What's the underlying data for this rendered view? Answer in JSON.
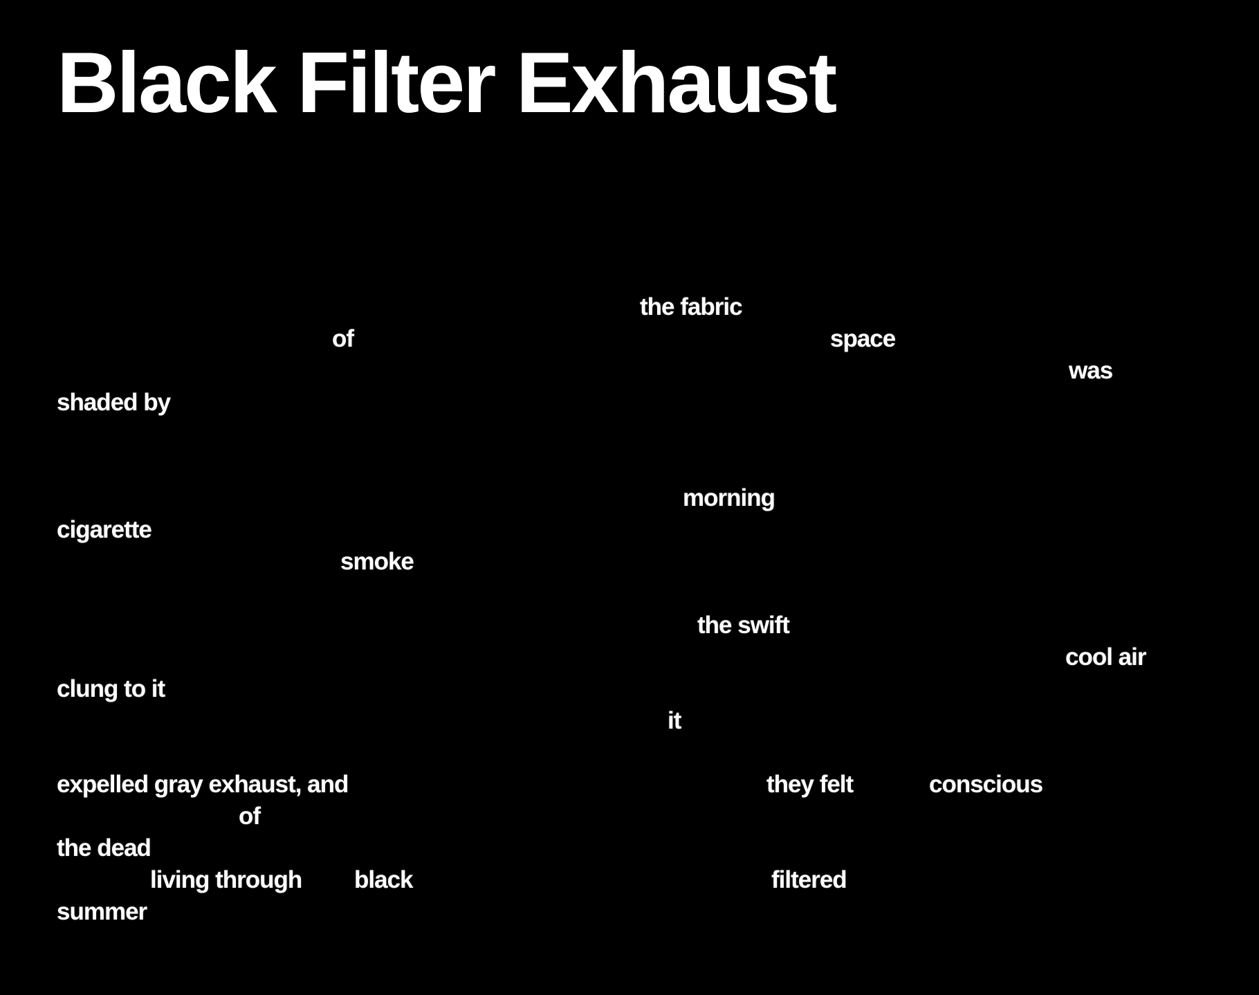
{
  "title": "Black Filter Exhaust",
  "words": [
    "the fabric",
    "of",
    "space",
    "was",
    "shaded by",
    "morning",
    "cigarette",
    "smoke",
    "the swift",
    "cool air",
    "clung to it",
    "it",
    "expelled gray exhaust, and",
    "they felt",
    "conscious",
    "of",
    "the dead",
    "living through",
    "black",
    "filtered",
    "summer"
  ],
  "colors": {
    "background": "#000000",
    "text": "#ffffff"
  }
}
